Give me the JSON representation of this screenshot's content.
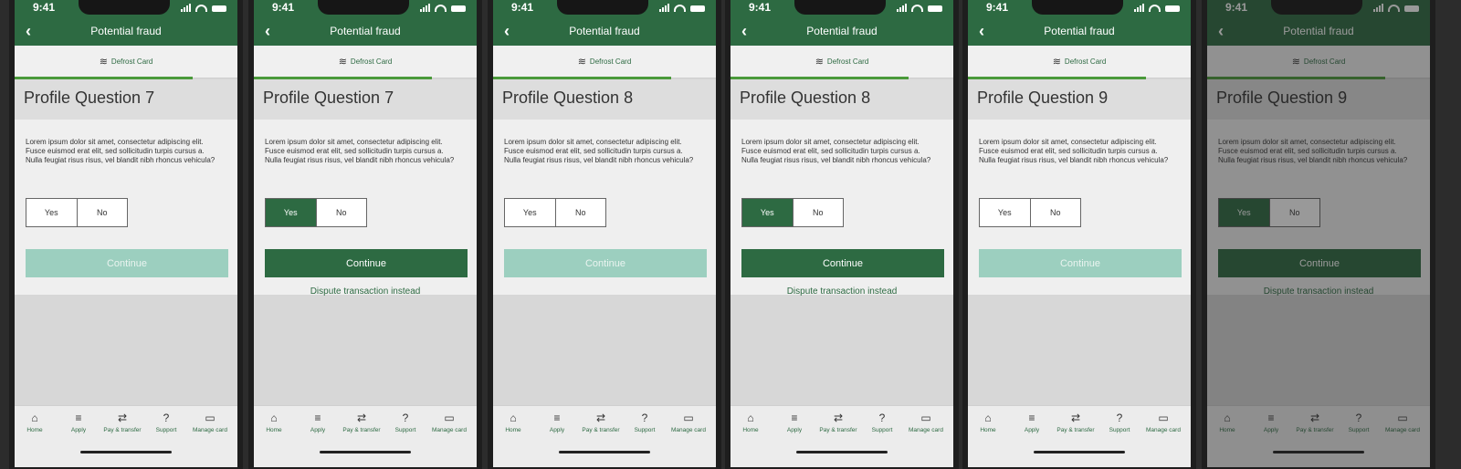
{
  "status": {
    "time": "9:41"
  },
  "nav": {
    "title": "Potential fraud"
  },
  "defrost": {
    "label": "Defrost Card",
    "icon": "heat-waves-icon"
  },
  "question": {
    "body": "Lorem ipsum dolor sit amet, consectetur adipiscing elit. Fusce euismod erat elit, sed sollicitudin turpis cursus a. Nulla feugiat risus risus, vel blandit nibh rhoncus vehicula?"
  },
  "options": {
    "yes": "Yes",
    "no": "No"
  },
  "actions": {
    "continue": "Continue",
    "dispute": "Dispute transaction instead"
  },
  "tabs": [
    {
      "label": "Home",
      "icon": "home-icon"
    },
    {
      "label": "Apply",
      "icon": "coins-icon"
    },
    {
      "label": "Pay & transfer",
      "icon": "transfer-icon"
    },
    {
      "label": "Support",
      "icon": "question-icon"
    },
    {
      "label": "Manage card",
      "icon": "card-icon"
    }
  ],
  "screens": [
    {
      "heading": "Profile Question 7",
      "selected": "none",
      "continue_enabled": false,
      "show_dispute": false,
      "progress": 0.8
    },
    {
      "heading": "Profile Question 7",
      "selected": "yes",
      "continue_enabled": true,
      "show_dispute": true,
      "progress": 0.8
    },
    {
      "heading": "Profile Question 8",
      "selected": "none",
      "continue_enabled": false,
      "show_dispute": false,
      "progress": 0.8
    },
    {
      "heading": "Profile Question 8",
      "selected": "yes",
      "continue_enabled": true,
      "show_dispute": true,
      "progress": 0.8
    },
    {
      "heading": "Profile Question 9",
      "selected": "none",
      "continue_enabled": false,
      "show_dispute": false,
      "progress": 0.8
    },
    {
      "heading": "Profile Question 9",
      "selected": "yes",
      "continue_enabled": true,
      "show_dispute": true,
      "progress": 0.8
    }
  ],
  "colors": {
    "brand_green": "#2d6a42",
    "disabled_green": "#9ccfbf",
    "progress_green": "#4a9a3a"
  }
}
